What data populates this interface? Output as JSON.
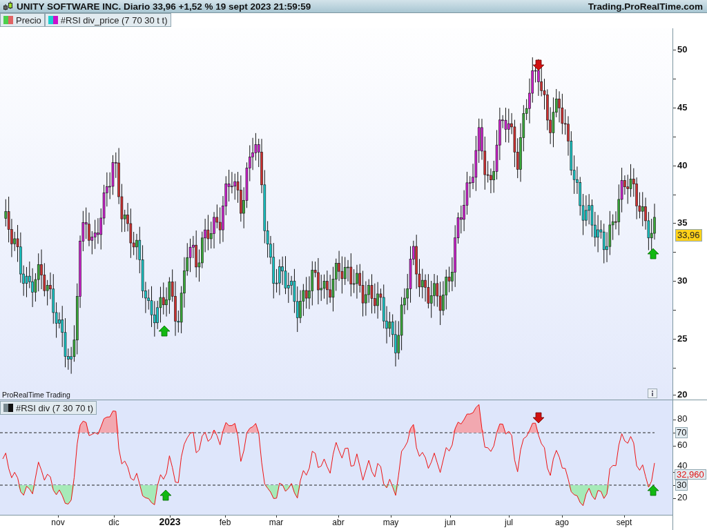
{
  "title_bar": {
    "title": "UNITY SOFTWARE INC. Diario 33,96 +1,52 % 19 sept 2023 21:59:59",
    "site": "Trading.ProRealTime.com"
  },
  "price_panel": {
    "legend": [
      {
        "label": "Precio",
        "kind": "price"
      },
      {
        "label": "#RSI div_price (7 70 30 t t)",
        "kind": "indicator"
      }
    ],
    "y_ticks": [
      "50",
      "45",
      "40",
      "35",
      "30",
      "25",
      "20"
    ],
    "last_price": "33,96",
    "footer_label": "ProRealTime Trading"
  },
  "rsi_panel": {
    "legend": [
      {
        "label": "#RSI div (7 30 70 t)",
        "kind": "oscillator"
      }
    ],
    "y_ticks": [
      {
        "label": "80",
        "boxed": false
      },
      {
        "label": "70",
        "boxed": true
      },
      {
        "label": "60",
        "boxed": false
      },
      {
        "label": "40",
        "boxed": false
      },
      {
        "label": "30",
        "boxed": true
      },
      {
        "label": "20",
        "boxed": false
      }
    ],
    "last_value": "32,960"
  },
  "x_axis": [
    {
      "label": "nov",
      "bold": false
    },
    {
      "label": "dic",
      "bold": false
    },
    {
      "label": "2023",
      "bold": true
    },
    {
      "label": "feb",
      "bold": false
    },
    {
      "label": "mar",
      "bold": false
    },
    {
      "label": "abr",
      "bold": false
    },
    {
      "label": "may",
      "bold": false
    },
    {
      "label": "jun",
      "bold": false
    },
    {
      "label": "jul",
      "bold": false
    },
    {
      "label": "ago",
      "bold": false
    },
    {
      "label": "sept",
      "bold": false
    }
  ]
}
